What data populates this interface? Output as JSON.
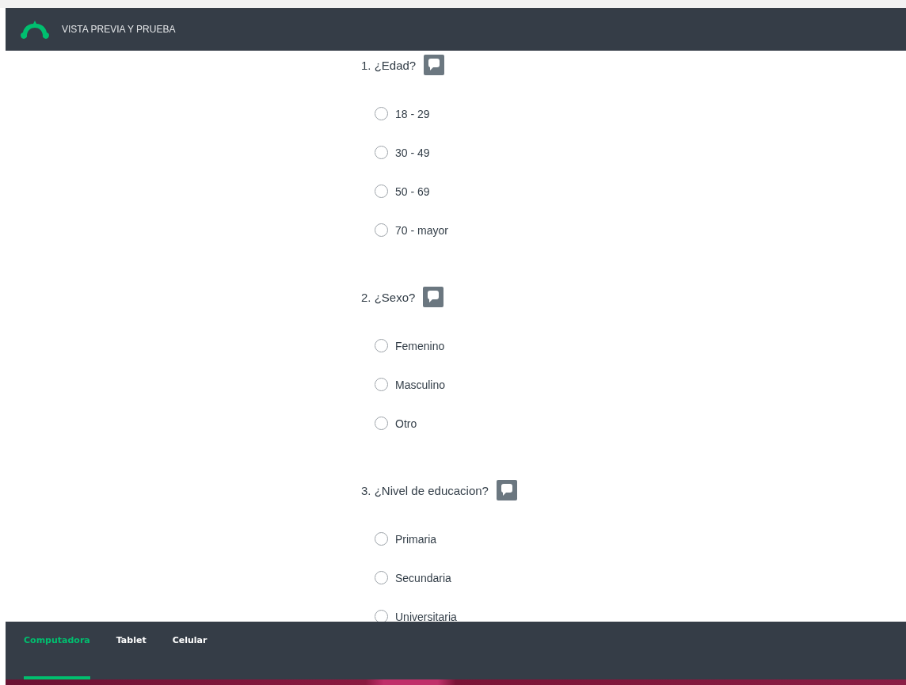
{
  "header": {
    "title": "VISTA PREVIA Y PRUEBA"
  },
  "questions": [
    {
      "title": "1. ¿Edad?",
      "options": [
        {
          "label": "18 - 29",
          "selected": false
        },
        {
          "label": "30 - 49",
          "selected": false
        },
        {
          "label": "50 - 69",
          "selected": false
        },
        {
          "label": "70 - mayor",
          "selected": false
        }
      ]
    },
    {
      "title": "2. ¿Sexo?",
      "options": [
        {
          "label": "Femenino",
          "selected": false
        },
        {
          "label": "Masculino",
          "selected": false
        },
        {
          "label": "Otro",
          "selected": false
        }
      ]
    },
    {
      "title": "3. ¿Nivel de educacion?",
      "options": [
        {
          "label": "Primaria",
          "selected": false
        },
        {
          "label": "Secundaria",
          "selected": false
        },
        {
          "label": "Universitaria",
          "selected": false
        }
      ]
    }
  ],
  "device_tabs": [
    {
      "label": "Computadora",
      "selected": true
    },
    {
      "label": "Tablet",
      "selected": false
    },
    {
      "label": "Celular",
      "selected": false
    }
  ]
}
